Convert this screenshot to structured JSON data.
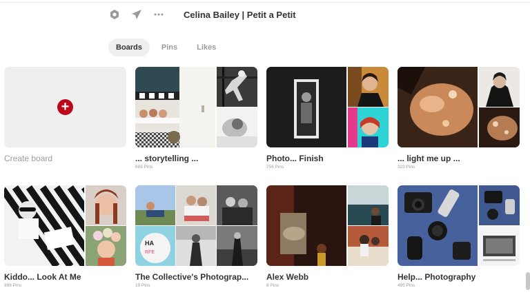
{
  "header": {
    "title": "Celina Bailey | Petit a Petit",
    "icons": [
      "settings-hexagon-icon",
      "send-icon",
      "more-icon"
    ]
  },
  "tabs": [
    {
      "label": "Boards",
      "active": true
    },
    {
      "label": "Pins",
      "active": false
    },
    {
      "label": "Likes",
      "active": false
    }
  ],
  "create_board": {
    "label": "Create board"
  },
  "boards": [
    {
      "name": "... storytelling ...",
      "pins": "685 Pins"
    },
    {
      "name": "Photo... Finish",
      "pins": "756 Pins"
    },
    {
      "name": "... light me up ...",
      "pins": "323 Pins"
    },
    {
      "name": "Kiddo... Look At Me",
      "pins": "998 Pins"
    },
    {
      "name": "The Collective's Photograp...",
      "pins": "19 Pins"
    },
    {
      "name": "Alex Webb",
      "pins": "8 Pins"
    },
    {
      "name": "Help... Photography",
      "pins": "495 Pins"
    }
  ],
  "colors": {
    "accent": "#bd081c",
    "tab_active_bg": "#efefef"
  }
}
